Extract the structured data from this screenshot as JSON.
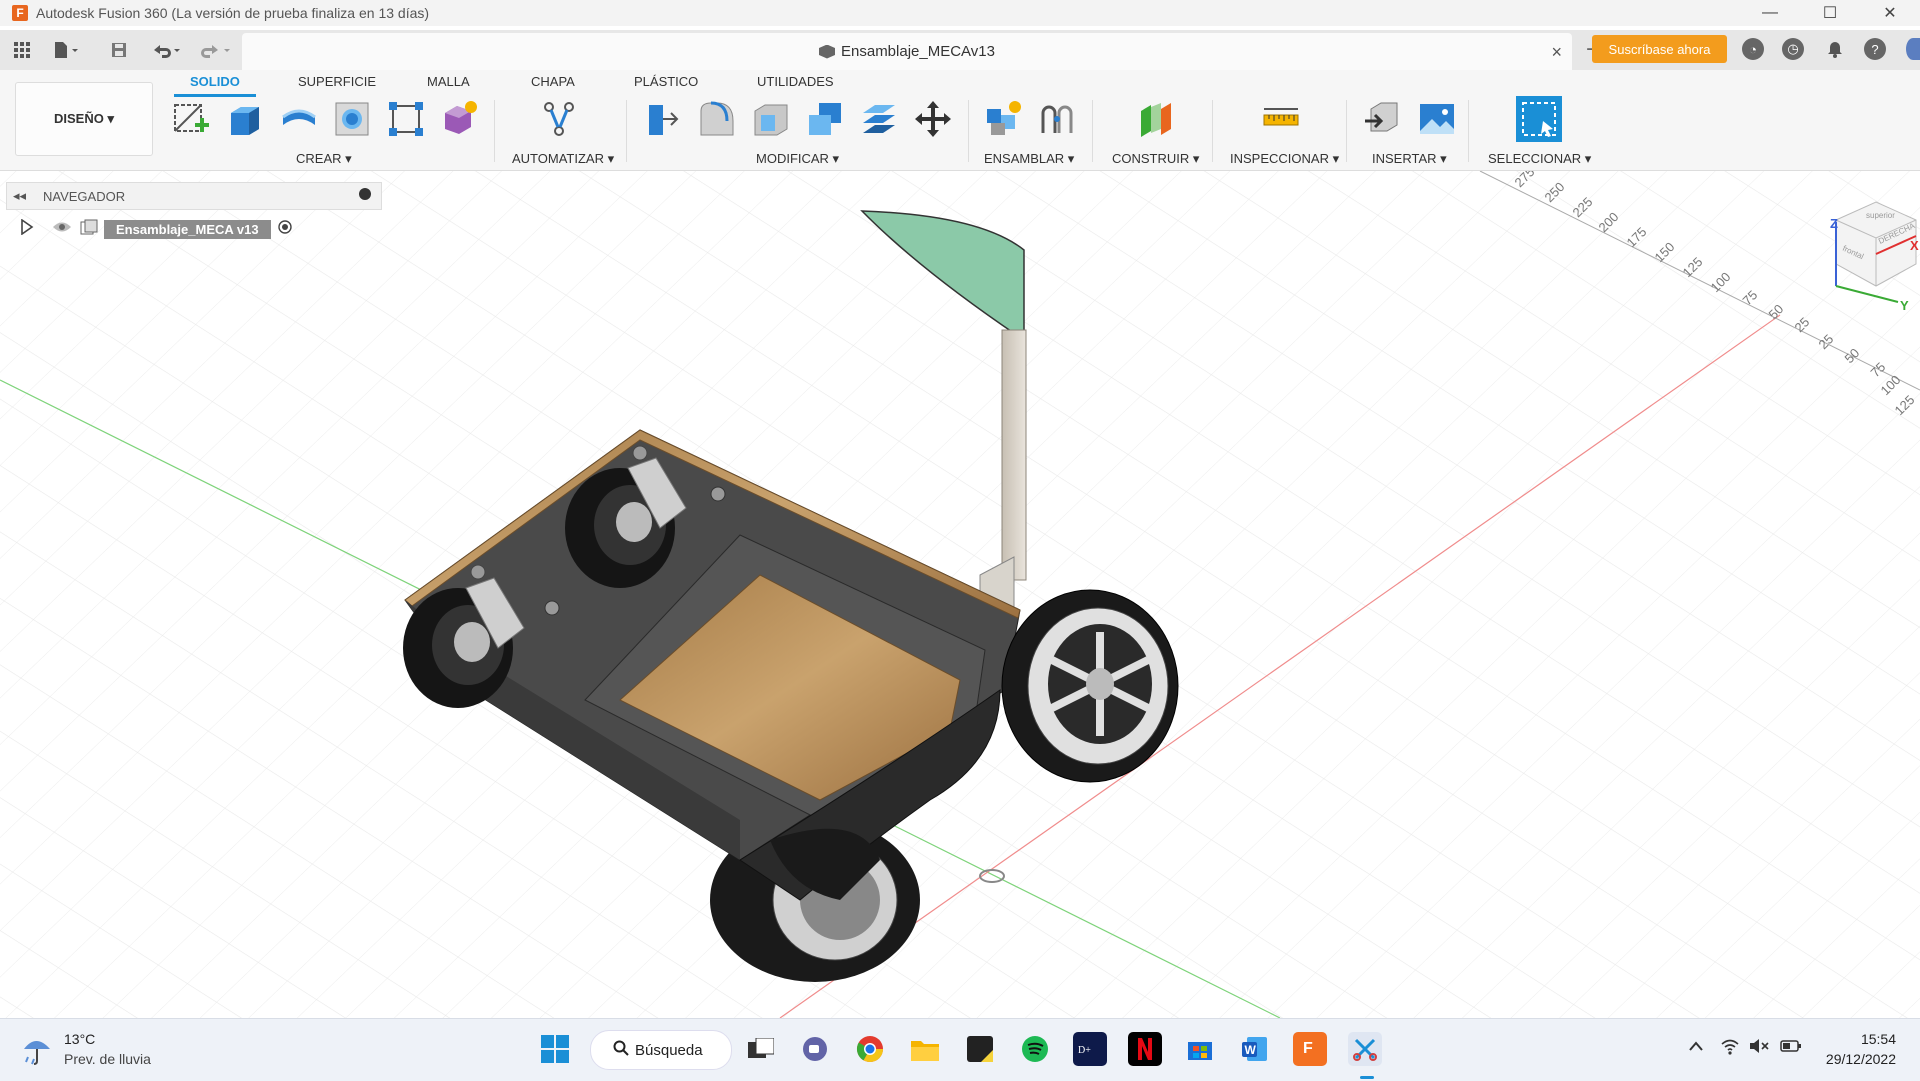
{
  "window": {
    "title": "Autodesk Fusion 360 (La versión de prueba finaliza en 13 días)",
    "app_icon": "F",
    "controls": [
      "minimize-icon",
      "maximize-icon",
      "close-icon"
    ]
  },
  "tabbar": {
    "document_name": "Ensamblaje_MECAv13",
    "close_glyph": "×",
    "new_tab_glyph": "+",
    "subscribe_label": "Suscríbase ahora"
  },
  "ribbon": {
    "workspace_label": "DISEÑO ▾",
    "tabs": [
      "SOLIDO",
      "SUPERFICIE",
      "MALLA",
      "CHAPA",
      "PLÁSTICO",
      "UTILIDADES"
    ],
    "active_tab": "SOLIDO",
    "groups": [
      "CREAR ▾",
      "AUTOMATIZAR ▾",
      "MODIFICAR ▾",
      "ENSAMBLAR ▾",
      "CONSTRUIR ▾",
      "INSPECCIONAR ▾",
      "INSERTAR ▾",
      "SELECCIONAR ▾"
    ]
  },
  "navigator": {
    "title": "NAVEGADOR",
    "collapse_glyph": "◂◂",
    "root_component": "Ensamblaje_MECA v13"
  },
  "viewcube": {
    "face_labels": [
      "DERECHA",
      "frontal",
      "superior"
    ],
    "axis_labels": [
      "Z",
      "X",
      "Y"
    ]
  },
  "ruler": {
    "upper_ticks": [
      "275",
      "250",
      "225",
      "200",
      "175",
      "150",
      "125",
      "100",
      "75",
      "50",
      "25"
    ],
    "lower_ticks": [
      "25",
      "50",
      "75",
      "100",
      "125"
    ]
  },
  "taskbar": {
    "weather_temp": "13°C",
    "weather_desc": "Prev. de lluvia",
    "search_label": "Búsqueda",
    "time": "15:54",
    "date": "29/12/2022"
  },
  "colors": {
    "accent_blue": "#1a8fd6",
    "subscribe_orange": "#f39c1d",
    "wood": "#b8915e",
    "body_gray": "#4a4a4a",
    "sign_green": "#8bc9a8"
  }
}
